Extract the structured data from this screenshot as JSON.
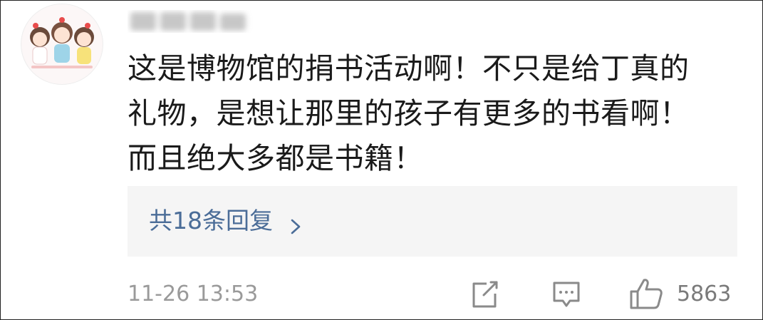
{
  "comment": {
    "lines": [
      "这是博物馆的捐书活动啊！不只是给丁真的",
      "礼物，是想让那里的孩子有更多的书看啊！",
      "而且绝大多都是书籍！"
    ]
  },
  "replies": {
    "label": "共18条回复"
  },
  "footer": {
    "timestamp": "11-26 13:53",
    "like_count": "5863"
  },
  "icons": {
    "share": "share-icon",
    "comment": "comment-icon",
    "like": "thumbs-up-icon",
    "chevron": "chevron-right-icon"
  },
  "colors": {
    "link": "#4b6d98",
    "meta": "#9a9a9a",
    "reply_bg": "#f5f5f5"
  }
}
